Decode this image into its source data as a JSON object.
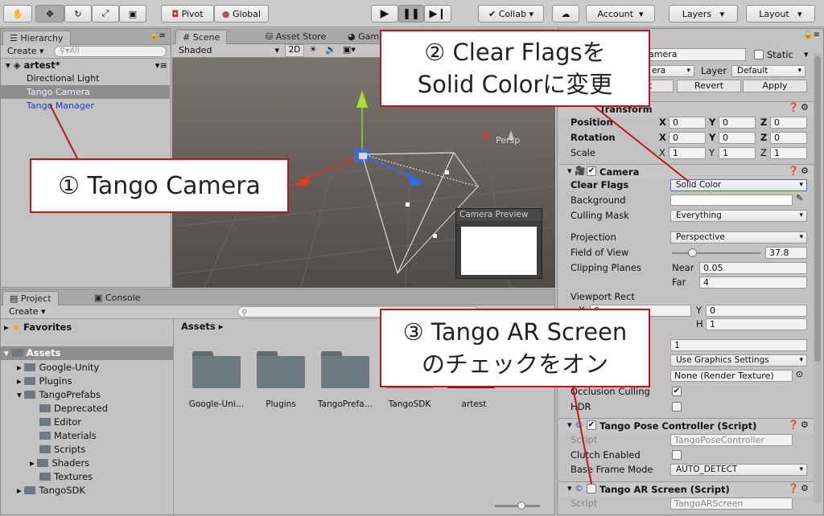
{
  "toolbar": {
    "pivot": "Pivot",
    "global": "Global",
    "collab": "Collab",
    "account": "Account",
    "layers": "Layers",
    "layout": "Layout"
  },
  "hierarchy": {
    "tab": "Hierarchy",
    "create": "Create",
    "search_placeholder": "All",
    "scene": "artest*",
    "items": [
      "Directional Light",
      "Tango Camera",
      "Tango Manager"
    ]
  },
  "scene_view": {
    "tabs": [
      "Scene",
      "Asset Store",
      "Gam"
    ],
    "shading": "Shaded",
    "mode2d": "2D",
    "persp": "Persp",
    "preview_title": "Camera Preview"
  },
  "project": {
    "tabs": [
      "Project",
      "Console"
    ],
    "create": "Create",
    "favorites": "Favorites",
    "assets": "Assets",
    "breadcrumb": "Assets",
    "tree": [
      {
        "label": "Google-Unity",
        "indent": 1
      },
      {
        "label": "Plugins",
        "indent": 1
      },
      {
        "label": "TangoPrefabs",
        "indent": 1
      },
      {
        "label": "Deprecated",
        "indent": 2
      },
      {
        "label": "Editor",
        "indent": 2
      },
      {
        "label": "Materials",
        "indent": 2
      },
      {
        "label": "Scripts",
        "indent": 2
      },
      {
        "label": "Shaders",
        "indent": 2
      },
      {
        "label": "Textures",
        "indent": 2
      },
      {
        "label": "TangoSDK",
        "indent": 1
      }
    ],
    "grid": [
      "Google-Uni…",
      "Plugins",
      "TangoPrefa…",
      "TangoSDK",
      "artest"
    ]
  },
  "inspector": {
    "name": "amera",
    "static": "Static",
    "tag_value": "era",
    "layer_label": "Layer",
    "layer_value": "Default",
    "revert": "Revert",
    "apply": "Apply",
    "select": "t",
    "transform": {
      "title": "Transform",
      "position": "Position",
      "rotation": "Rotation",
      "scale": "Scale",
      "pos": [
        "0",
        "0",
        "0"
      ],
      "rot": [
        "0",
        "0",
        "0"
      ],
      "scl": [
        "1",
        "1",
        "1"
      ],
      "axes": [
        "X",
        "Y",
        "Z"
      ]
    },
    "camera": {
      "title": "Camera",
      "clear_flags_label": "Clear Flags",
      "clear_flags": "Solid Color",
      "background_label": "Background",
      "culling_label": "Culling Mask",
      "culling": "Everything",
      "projection_label": "Projection",
      "projection": "Perspective",
      "fov_label": "Field of View",
      "fov": "37.8",
      "clip_label": "Clipping Planes",
      "near_label": "Near",
      "near": "0.05",
      "far_label": "Far",
      "far": "4",
      "viewport_label": "Viewport Rect",
      "vp_x_label": "X",
      "vp_x": "0",
      "vp_y_label": "Y",
      "vp_y": "0",
      "vp_h_label": "H",
      "vp_h": "1",
      "depth": "1",
      "rendering_path": "Use Graphics Settings",
      "target_texture": "None (Render Texture)",
      "occlusion_label": "Occlusion Culling",
      "hdr_label": "HDR"
    },
    "pose": {
      "title": "Tango Pose Controller (Script)",
      "script_label": "Script",
      "script": "TangoPoseController",
      "clutch_label": "Clutch Enabled",
      "frame_label": "Base Frame Mode",
      "frame": "AUTO_DETECT"
    },
    "ar": {
      "title": "Tango AR Screen (Script)",
      "script_label": "Script",
      "script": "TangoARScreen"
    }
  },
  "callouts": {
    "c1": "① Tango Camera",
    "c2_line1": "② Clear Flagsを",
    "c2_line2": "Solid Colorに変更",
    "c3_line1": "③ Tango AR Screen",
    "c3_line2": "のチェックをオン"
  },
  "colors": {
    "accent": "#b71c1c",
    "selection": "#8e8e8e",
    "link": "#2143b8"
  }
}
